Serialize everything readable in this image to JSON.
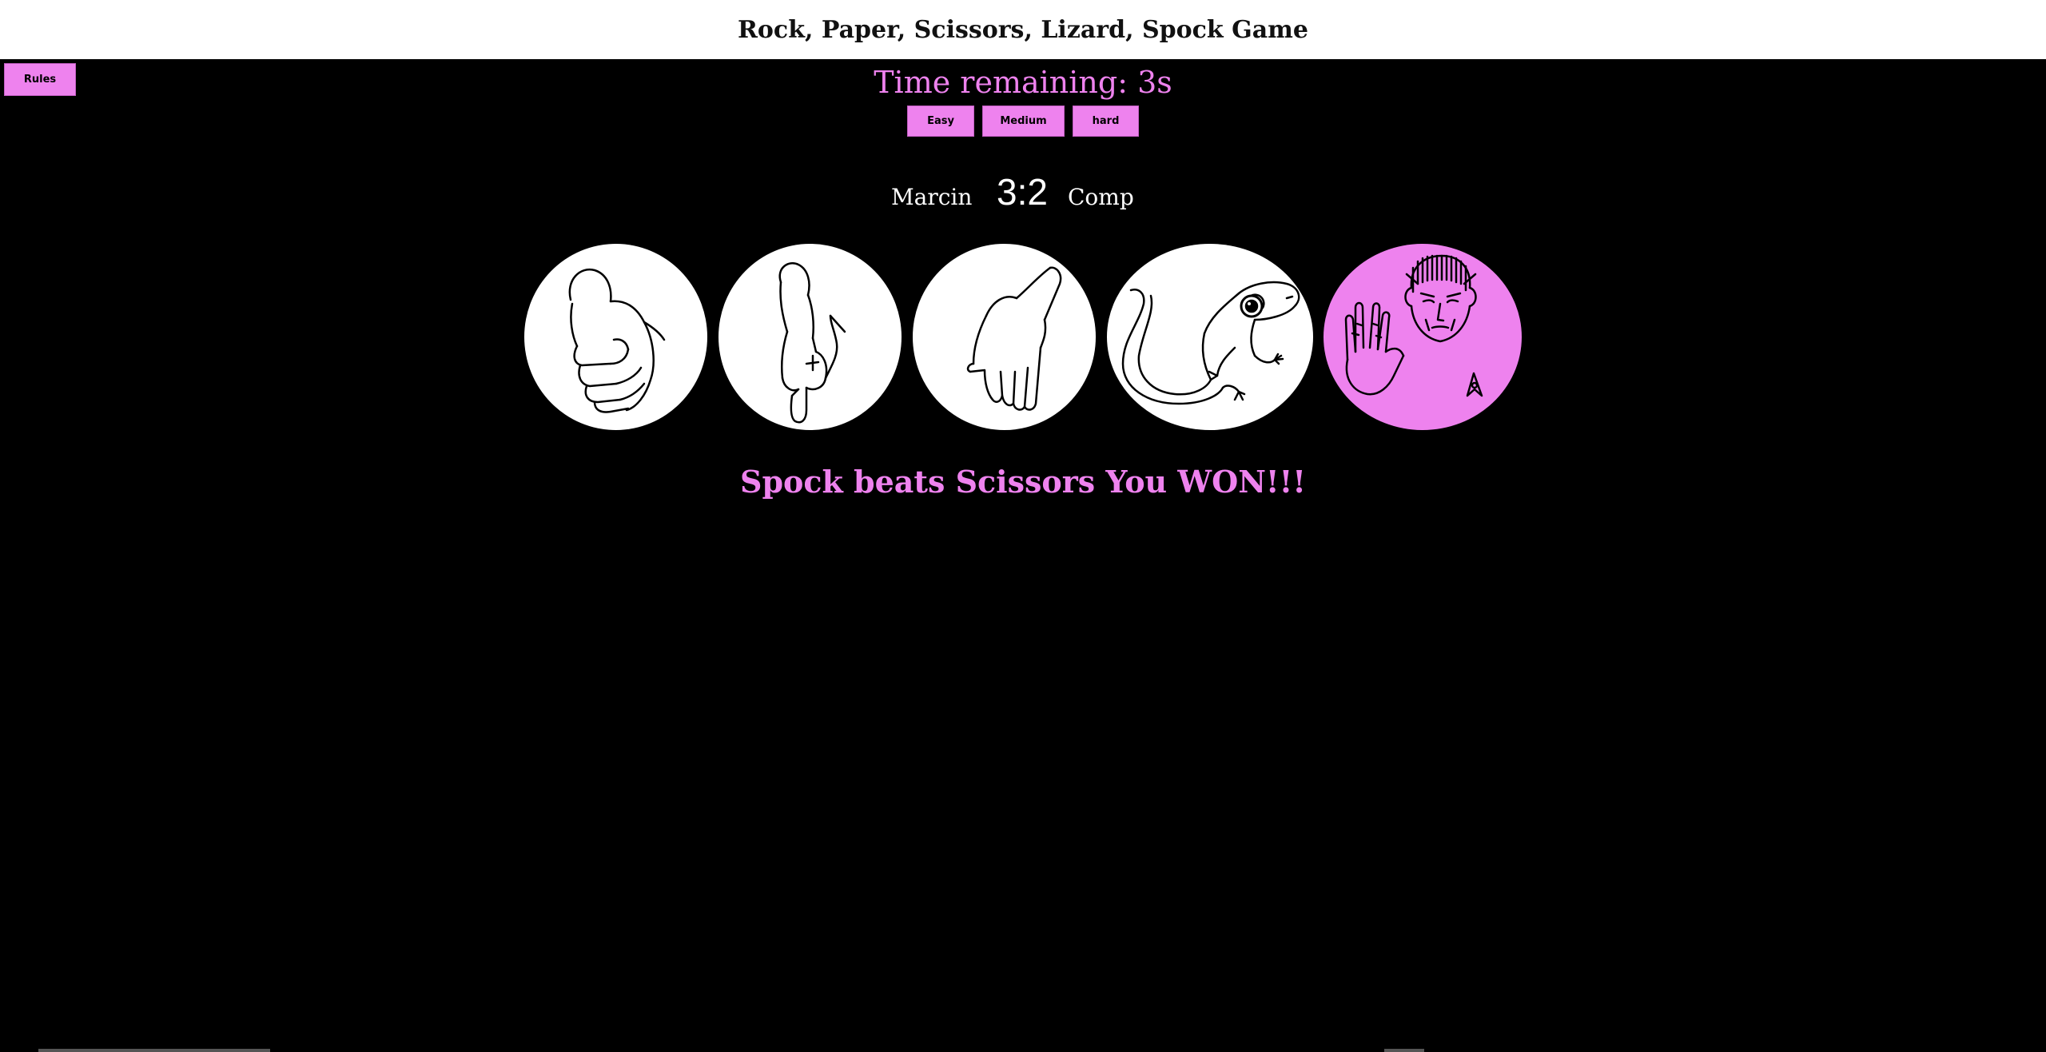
{
  "header": {
    "title": "Rock, Paper, Scissors, Lizard, Spock Game"
  },
  "rules_button": {
    "label": "Rules"
  },
  "timer": {
    "text": "Time remaining: 3s"
  },
  "difficulty": {
    "easy_label": "Easy",
    "medium_label": "Medium",
    "hard_label": "hard"
  },
  "scoreboard": {
    "player": "Marcin",
    "score": "3:2",
    "opponent": "Comp"
  },
  "choices": [
    {
      "name": "rock",
      "icon": "fist-icon",
      "selected": false
    },
    {
      "name": "scissors",
      "icon": "pointing-finger-icon",
      "selected": false
    },
    {
      "name": "paper",
      "icon": "open-hand-icon",
      "selected": false
    },
    {
      "name": "lizard",
      "icon": "gecko-icon",
      "selected": false
    },
    {
      "name": "spock",
      "icon": "spock-icon",
      "selected": true
    }
  ],
  "result": {
    "text": "Spock beats Scissors You WON!!!"
  },
  "colors": {
    "accent": "#ee82ee",
    "background": "#000000",
    "header_bg": "#ffffff"
  }
}
